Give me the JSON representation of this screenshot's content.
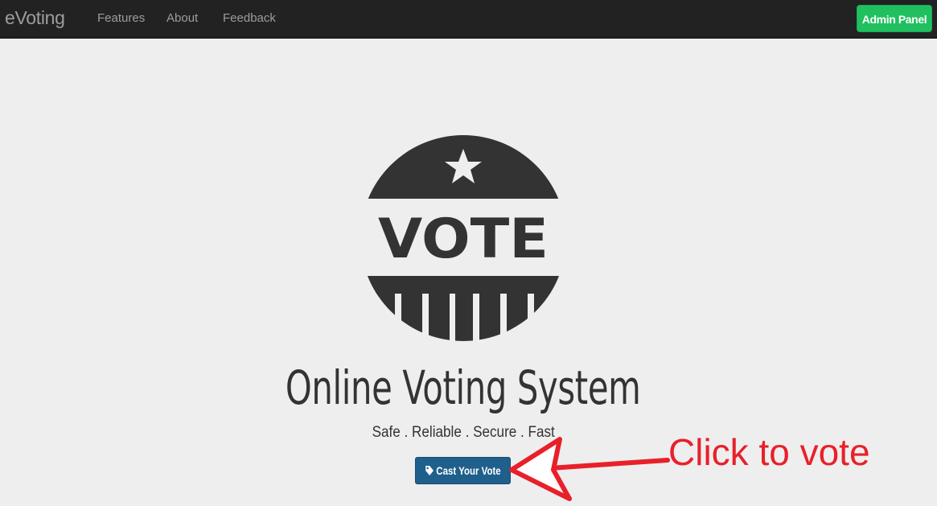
{
  "navbar": {
    "brand": "eVoting",
    "links": [
      {
        "label": "Features"
      },
      {
        "label": "About"
      },
      {
        "label": "Feedback"
      }
    ],
    "admin_button": "Admin Panel"
  },
  "hero": {
    "logo_text": "VOTE",
    "logo_icon": "star-icon",
    "title": "Online Voting System",
    "subtitle": "Safe . Reliable . Secure . Fast",
    "cta_label": "Cast Your Vote",
    "cta_icon": "tag-icon"
  },
  "annotation": {
    "text": "Click to vote",
    "color": "#e8202a"
  },
  "colors": {
    "navbar_bg": "#222222",
    "admin_button": "#20c060",
    "cta_button": "#1f5f8b",
    "page_bg": "#eeeeee",
    "logo": "#333333"
  }
}
